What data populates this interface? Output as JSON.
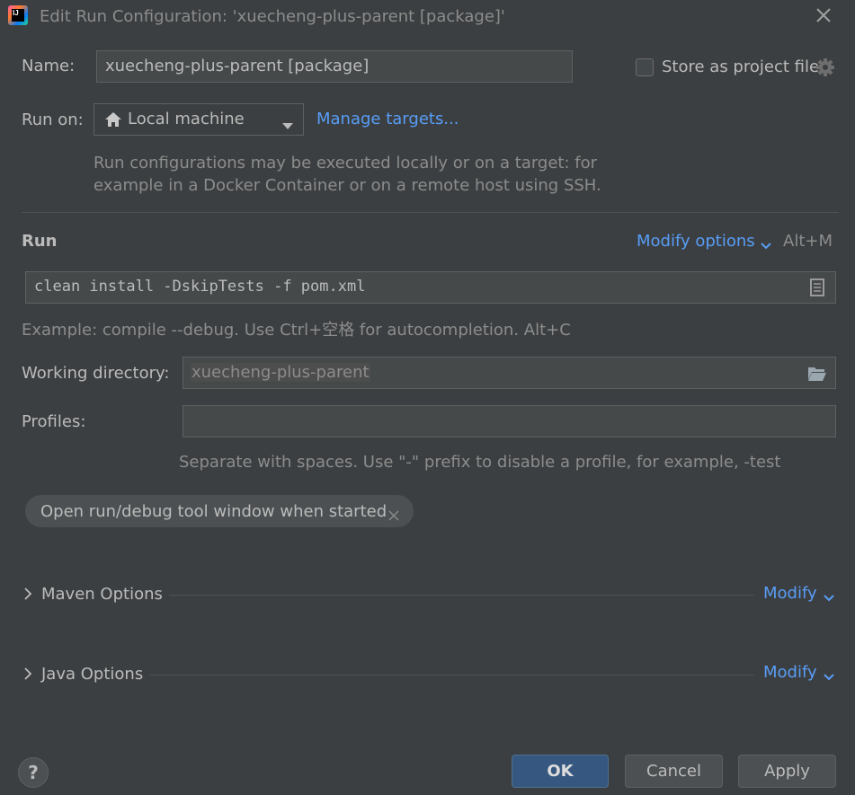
{
  "window": {
    "title": "Edit Run Configuration: 'xuecheng-plus-parent [package]'",
    "logo_text": "IJ"
  },
  "name_row": {
    "label": "Name:",
    "value": "xuecheng-plus-parent [package]",
    "store_as_project_file": "Store as project file",
    "store_checked": false
  },
  "run_on": {
    "label": "Run on:",
    "selected": "Local machine",
    "manage_targets": "Manage targets...",
    "description_line1": "Run configurations may be executed locally or on a target: for",
    "description_line2": "example in a Docker Container or on a remote host using SSH."
  },
  "run_section": {
    "title": "Run",
    "modify_options": "Modify options",
    "modify_shortcut": "Alt+M",
    "command_line": "clean install -DskipTests -f pom.xml",
    "example_hint": "Example: compile --debug. Use Ctrl+空格 for autocompletion. Alt+C"
  },
  "working_directory": {
    "label": "Working directory:",
    "value": "xuecheng-plus-parent"
  },
  "profiles": {
    "label": "Profiles:",
    "value": "",
    "hint": "Separate with spaces. Use \"-\" prefix to disable a profile, for example, -test"
  },
  "chip": {
    "label": "Open run/debug tool window when started"
  },
  "maven_options": {
    "title": "Maven Options",
    "modify": "Modify"
  },
  "java_options": {
    "title": "Java Options",
    "modify": "Modify"
  },
  "footer": {
    "help": "?",
    "ok": "OK",
    "cancel": "Cancel",
    "apply": "Apply"
  },
  "colors": {
    "background": "#3c3f41",
    "input_bg": "#45494a",
    "link": "#589df6",
    "ok_button": "#365880"
  }
}
